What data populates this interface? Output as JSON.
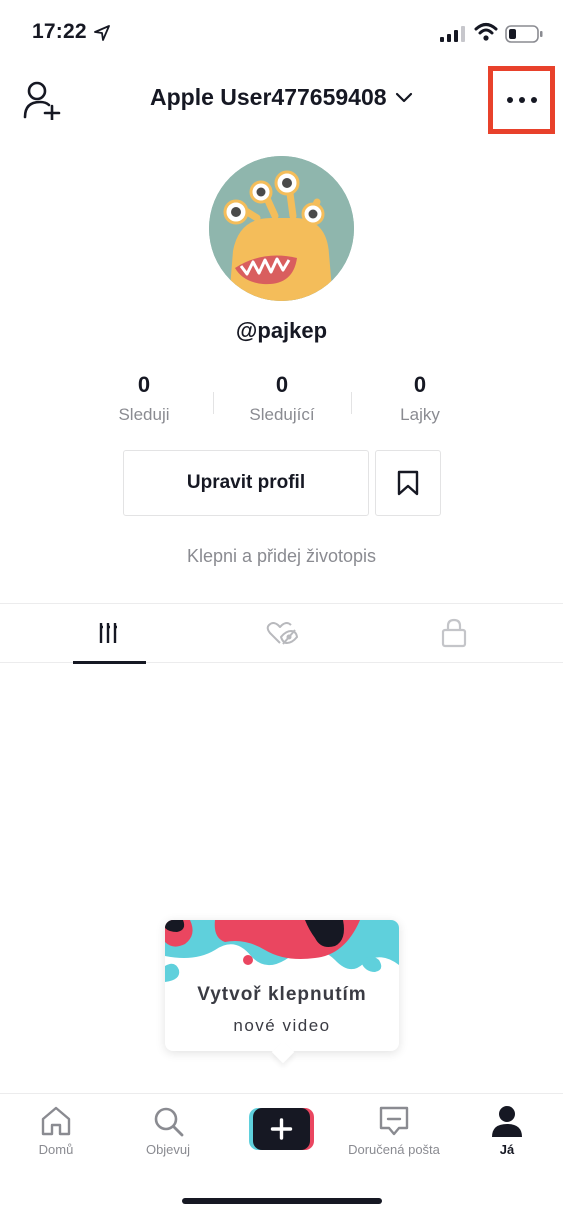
{
  "status_bar": {
    "time": "17:22",
    "location_icon": "location-arrow-icon",
    "signal_icon": "cellular-signal-icon",
    "wifi_icon": "wifi-icon",
    "battery_icon": "battery-low-icon"
  },
  "header": {
    "title": "Apple User477659408",
    "add_user_icon": "add-user-icon",
    "more_icon": "more-dots-icon",
    "highlight_color": "#e8412b"
  },
  "profile": {
    "handle": "@pajkep",
    "stats": [
      {
        "value": "0",
        "label": "Sleduji"
      },
      {
        "value": "0",
        "label": "Sledující"
      },
      {
        "value": "0",
        "label": "Lajky"
      }
    ],
    "edit_button": "Upravit profil",
    "bio_placeholder": "Klepni a přidej životopis"
  },
  "tabs": [
    {
      "icon": "video-grid-icon",
      "active": true
    },
    {
      "icon": "liked-hidden-icon",
      "active": false
    },
    {
      "icon": "lock-icon",
      "active": false
    }
  ],
  "popup": {
    "title": "Vytvoř klepnutím",
    "subtitle": "nové video"
  },
  "bottom_nav": [
    {
      "label": "Domů",
      "icon": "home-icon"
    },
    {
      "label": "Objevuj",
      "icon": "search-icon"
    },
    {
      "label": "",
      "icon": "create-plus-icon"
    },
    {
      "label": "Doručená pošta",
      "icon": "inbox-icon"
    },
    {
      "label": "Já",
      "icon": "profile-icon",
      "active": true
    }
  ]
}
